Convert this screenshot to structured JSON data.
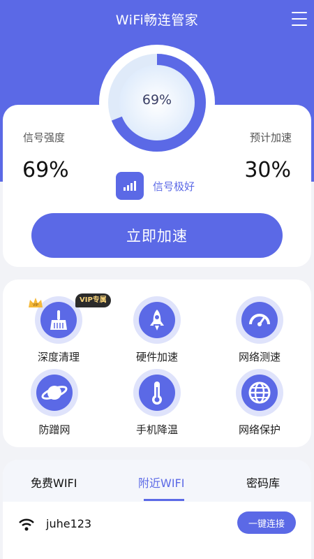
{
  "app": {
    "title": "WiFi畅连管家"
  },
  "status": {
    "gauge_percent": "69%",
    "gauge_fraction": 0.69,
    "signal_strength_label": "信号强度",
    "signal_strength_value": "69%",
    "predicted_boost_label": "预计加速",
    "predicted_boost_value": "30%",
    "signal_quality": "信号极好",
    "boost_button": "立即加速"
  },
  "tools": [
    {
      "label": "深度清理",
      "icon": "broom-icon",
      "badge": "VIP专属"
    },
    {
      "label": "硬件加速",
      "icon": "rocket-icon"
    },
    {
      "label": "网络测速",
      "icon": "speedometer-icon"
    },
    {
      "label": "防蹭网",
      "icon": "planet-icon"
    },
    {
      "label": "手机降温",
      "icon": "thermometer-icon"
    },
    {
      "label": "网络保护",
      "icon": "globe-icon"
    }
  ],
  "wifi": {
    "tabs": [
      "免费WIFI",
      "附近WIFI",
      "密码库"
    ],
    "active_tab": 1,
    "networks": [
      {
        "ssid": "juhe123",
        "action": "一键连接"
      }
    ]
  },
  "colors": {
    "primary": "#5b69e6",
    "ring_light": "#dfe3fb",
    "background": "#f2f3f7"
  }
}
